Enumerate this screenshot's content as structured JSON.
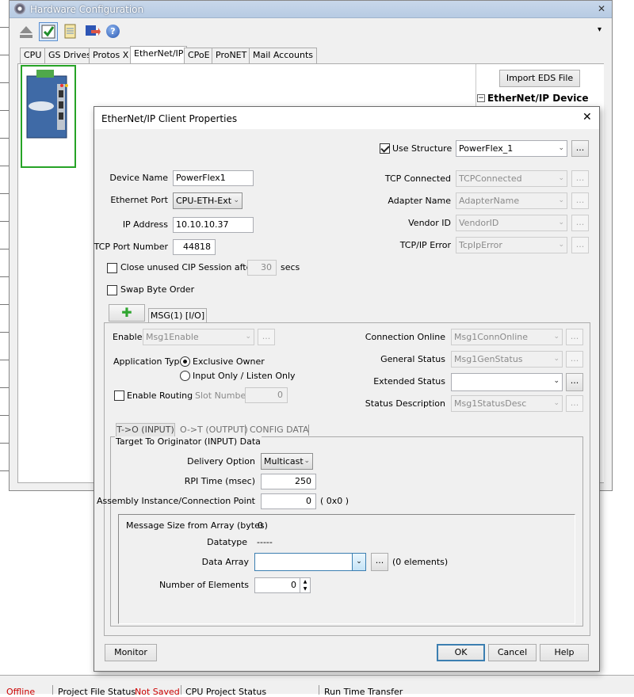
{
  "bg_window": {
    "title": "Hardware Configuration",
    "close_glyph": "✕",
    "dropdown_glyph": "▾",
    "toolbar_icons": [
      "eject-icon",
      "check-icon",
      "document-icon",
      "transfer-icon",
      "help-icon"
    ],
    "help_glyph": "?",
    "tabs": [
      "CPU",
      "GS Drives",
      "Protos X",
      "EtherNet/IP",
      "CPoE",
      "ProNET",
      "Mail Accounts"
    ],
    "active_tab": "EtherNet/IP",
    "import_button": "Import EDS File",
    "tree_header": "EtherNet/IP Device",
    "tree_toggle": "−"
  },
  "dialog": {
    "title": "EtherNet/IP Client Properties",
    "close_glyph": "✕",
    "use_structure_label": "Use Structure",
    "use_structure_checked": true,
    "structure_value": "PowerFlex_1",
    "left_fields": {
      "device_name_label": "Device Name",
      "device_name": "PowerFlex1",
      "ethernet_port_label": "Ethernet Port",
      "ethernet_port": "CPU-ETH-Ext",
      "ip_address_label": "IP Address",
      "ip_address": "10.10.10.37",
      "tcp_port_label": "TCP Port Number",
      "tcp_port": "44818",
      "close_unused_label": "Close unused CIP Session after",
      "close_unused_value": "30",
      "secs_label": "secs",
      "swap_label": "Swap Byte Order"
    },
    "right_fields": [
      {
        "label": "TCP Connected",
        "value": "TCPConnected"
      },
      {
        "label": "Adapter Name",
        "value": "AdapterName"
      },
      {
        "label": "Vendor ID",
        "value": "VendorID"
      },
      {
        "label": "TCP/IP Error",
        "value": "TcpIpError"
      }
    ],
    "add_glyph": "✚",
    "msg_tab": "MSG(1) [I/O]",
    "msg": {
      "enable_label": "Enable",
      "enable_value": "Msg1Enable",
      "app_type_label": "Application Type",
      "radio_exclusive": "Exclusive Owner",
      "radio_input_only": "Input Only / Listen Only",
      "enable_routing_label": "Enable Routing",
      "slot_number_label": "Slot Number",
      "slot_number": "0",
      "right": [
        {
          "label": "Connection Online",
          "value": "Msg1ConnOnline"
        },
        {
          "label": "General Status",
          "value": "Msg1GenStatus"
        },
        {
          "label": "Extended Status",
          "value": ""
        },
        {
          "label": "Status Description",
          "value": "Msg1StatusDesc"
        }
      ],
      "sub_tabs": [
        "T->O (INPUT)",
        "O->T (OUTPUT)",
        "CONFIG DATA"
      ],
      "group_title": "Target To Originator (INPUT) Data",
      "delivery_label": "Delivery Option",
      "delivery_value": "Multicast",
      "rpi_label": "RPI Time (msec)",
      "rpi_value": "250",
      "assembly_label": "Assembly Instance/Connection Point",
      "assembly_value": "0",
      "assembly_hex": "( 0x0 )",
      "msg_size_label": "Message Size from Array (bytes)",
      "msg_size_value": "0",
      "datatype_label": "Datatype",
      "datatype_value": "-----",
      "data_array_label": "Data Array",
      "data_array_value": "",
      "elements_text": "(0 elements)",
      "num_elements_label": "Number of Elements",
      "num_elements_value": "0"
    },
    "ellipsis": "...",
    "combo_arrow": "⌄",
    "buttons": {
      "monitor": "Monitor",
      "ok": "OK",
      "cancel": "Cancel",
      "help": "Help"
    }
  },
  "status_bar": {
    "offline": "Offline",
    "project_file_status_label": "Project File Status",
    "project_file_status_value": "Not Saved",
    "cpu_project_status": "CPU Project Status",
    "run_time_transfer": "Run Time Transfer"
  }
}
